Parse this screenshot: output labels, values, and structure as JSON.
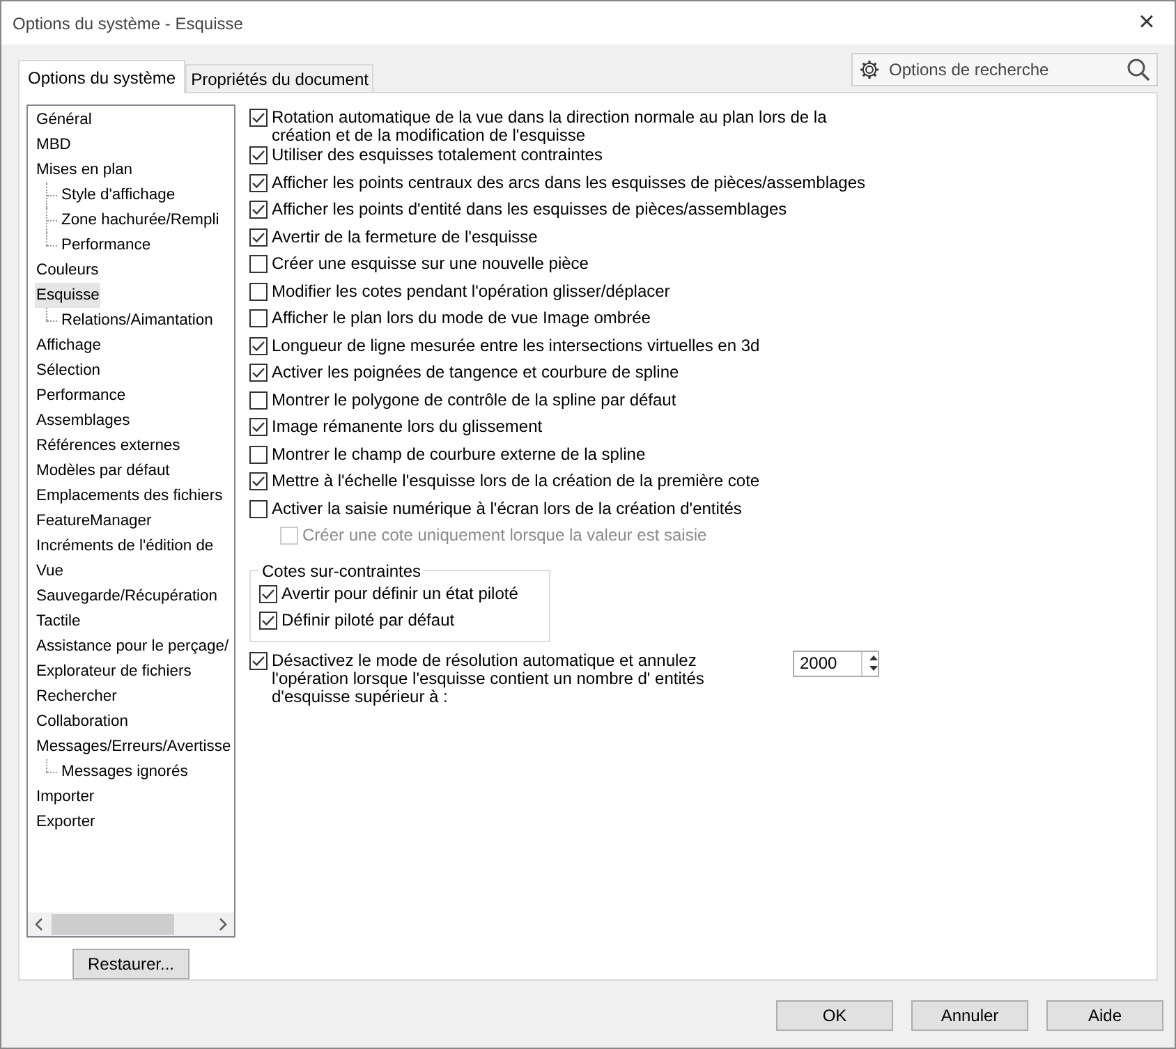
{
  "window": {
    "title": "Options du système - Esquisse",
    "close": "×"
  },
  "tabs": [
    {
      "label": "Options du système",
      "selected": true
    },
    {
      "label": "Propriétés du document",
      "selected": false
    }
  ],
  "search": {
    "placeholder": "Options de recherche"
  },
  "sidebar": {
    "items": [
      {
        "label": "Général",
        "selected": false
      },
      {
        "label": "MBD",
        "selected": false
      },
      {
        "label": "Mises en plan",
        "selected": false,
        "children": [
          {
            "label": "Style d'affichage",
            "selected": false
          },
          {
            "label": "Zone hachurée/Rempli",
            "selected": false
          },
          {
            "label": "Performance",
            "selected": false
          }
        ]
      },
      {
        "label": "Couleurs",
        "selected": false
      },
      {
        "label": "Esquisse",
        "selected": true,
        "children": [
          {
            "label": "Relations/Aimantation",
            "selected": false
          }
        ]
      },
      {
        "label": "Affichage",
        "selected": false
      },
      {
        "label": "Sélection",
        "selected": false
      },
      {
        "label": "Performance",
        "selected": false
      },
      {
        "label": "Assemblages",
        "selected": false
      },
      {
        "label": "Références externes",
        "selected": false
      },
      {
        "label": "Modèles par défaut",
        "selected": false
      },
      {
        "label": "Emplacements des fichiers",
        "selected": false
      },
      {
        "label": "FeatureManager",
        "selected": false
      },
      {
        "label": "Incréments de l'édition de",
        "selected": false
      },
      {
        "label": "Vue",
        "selected": false
      },
      {
        "label": "Sauvegarde/Récupération",
        "selected": false
      },
      {
        "label": "Tactile",
        "selected": false
      },
      {
        "label": "Assistance pour le perçage/",
        "selected": false
      },
      {
        "label": "Explorateur de fichiers",
        "selected": false
      },
      {
        "label": "Rechercher",
        "selected": false
      },
      {
        "label": "Collaboration",
        "selected": false
      },
      {
        "label": "Messages/Erreurs/Avertisse",
        "selected": false,
        "children": [
          {
            "label": "Messages ignorés",
            "selected": false
          }
        ]
      },
      {
        "label": "Importer",
        "selected": false
      },
      {
        "label": "Exporter",
        "selected": false
      }
    ]
  },
  "options": [
    {
      "label": "Rotation automatique de la vue dans la direction normale au plan lors de la création et de la modification de l'esquisse",
      "checked": true,
      "disabled": false
    },
    {
      "label": "Utiliser des esquisses totalement contraintes",
      "checked": true,
      "disabled": false
    },
    {
      "label": "Afficher les points centraux des arcs dans les esquisses de pièces/assemblages",
      "checked": true,
      "disabled": false
    },
    {
      "label": "Afficher les points d'entité dans les esquisses de pièces/assemblages",
      "checked": true,
      "disabled": false
    },
    {
      "label": "Avertir de la fermeture de l'esquisse",
      "checked": true,
      "disabled": false
    },
    {
      "label": "Créer une esquisse sur une nouvelle pièce",
      "checked": false,
      "disabled": false
    },
    {
      "label": "Modifier les cotes pendant l'opération glisser/déplacer",
      "checked": false,
      "disabled": false
    },
    {
      "label": "Afficher le plan lors du mode de vue Image ombrée",
      "checked": false,
      "disabled": false
    },
    {
      "label": "Longueur de ligne mesurée entre les intersections virtuelles en 3d",
      "checked": true,
      "disabled": false
    },
    {
      "label": "Activer les poignées de tangence et courbure de spline",
      "checked": true,
      "disabled": false
    },
    {
      "label": "Montrer le polygone de contrôle de la spline par défaut",
      "checked": false,
      "disabled": false
    },
    {
      "label": "Image rémanente lors du glissement",
      "checked": true,
      "disabled": false
    },
    {
      "label": "Montrer le champ de courbure externe de la spline",
      "checked": false,
      "disabled": false
    },
    {
      "label": "Mettre à l'échelle l'esquisse lors de la création de la première cote",
      "checked": true,
      "disabled": false
    },
    {
      "label": "Activer la saisie numérique à l'écran lors de la création d'entités",
      "checked": false,
      "disabled": false,
      "children": [
        {
          "label": "Créer une cote uniquement lorsque la valeur est saisie",
          "checked": false,
          "disabled": true
        }
      ]
    }
  ],
  "group": {
    "title": "Cotes sur-contraintes",
    "options": [
      {
        "label": "Avertir pour définir un état piloté",
        "checked": true,
        "disabled": false
      },
      {
        "label": "Définir piloté par défaut",
        "checked": true,
        "disabled": false
      }
    ]
  },
  "limit": {
    "label": "Désactivez le mode de résolution automatique et annulez l'opération lorsque l'esquisse contient un nombre d' entités d'esquisse supérieur à :",
    "checked": true,
    "disabled": false,
    "value": "2000"
  },
  "restore_button": "Restaurer...",
  "buttons": [
    "OK",
    "Annuler",
    "Aide"
  ]
}
